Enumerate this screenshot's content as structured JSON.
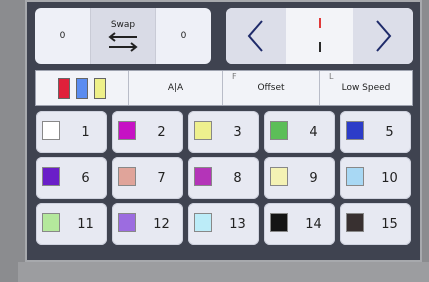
{
  "swap": {
    "left_value": "0",
    "label": "Swap",
    "right_value": "0"
  },
  "nav": {
    "prev_icon": "chevron-left-icon",
    "next_icon": "chevron-right-icon",
    "marker_colors": [
      "#e03a3a",
      "#2a2a2a"
    ]
  },
  "toolbar": {
    "swatch_colors": [
      "#e0203a",
      "#5b8cf0",
      "#eef08a"
    ],
    "mode_label": "A|A",
    "offset_prefix": "F",
    "offset_label": "Offset",
    "speed_prefix": "L",
    "speed_label": "Low Speed"
  },
  "colors": [
    {
      "number": "1",
      "color": "#ffffff"
    },
    {
      "number": "2",
      "color": "#c612c4"
    },
    {
      "number": "3",
      "color": "#eef08e"
    },
    {
      "number": "4",
      "color": "#5cbe58"
    },
    {
      "number": "5",
      "color": "#2c3cc8"
    },
    {
      "number": "6",
      "color": "#6a1ec8"
    },
    {
      "number": "7",
      "color": "#e0a49a"
    },
    {
      "number": "8",
      "color": "#b434b8"
    },
    {
      "number": "9",
      "color": "#f4f2b4"
    },
    {
      "number": "10",
      "color": "#a8d8f4"
    },
    {
      "number": "11",
      "color": "#b4e89c"
    },
    {
      "number": "12",
      "color": "#9c6ce0"
    },
    {
      "number": "13",
      "color": "#bcecf8"
    },
    {
      "number": "14",
      "color": "#141414"
    },
    {
      "number": "15",
      "color": "#383030"
    }
  ]
}
